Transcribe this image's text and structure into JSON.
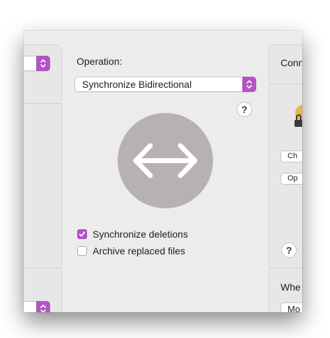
{
  "operation": {
    "label": "Operation:",
    "selected": "Synchronize Bidirectional",
    "help": "?"
  },
  "options": {
    "sync_deletions": {
      "label": "Synchronize deletions",
      "checked": true
    },
    "archive_replaced": {
      "label": "Archive replaced files",
      "checked": false
    }
  },
  "right_panel": {
    "title_partial": "Conn",
    "button1_partial": "Ch",
    "button2_partial": "Op",
    "help": "?",
    "section2_partial": "Whe",
    "popup_partial": "Mo"
  },
  "colors": {
    "accent": "#b553c6",
    "icon_circle": "#b8b1b1"
  },
  "icons": {
    "sync_arrow": "bidirectional-arrow-icon",
    "lock": "lock-icon"
  }
}
